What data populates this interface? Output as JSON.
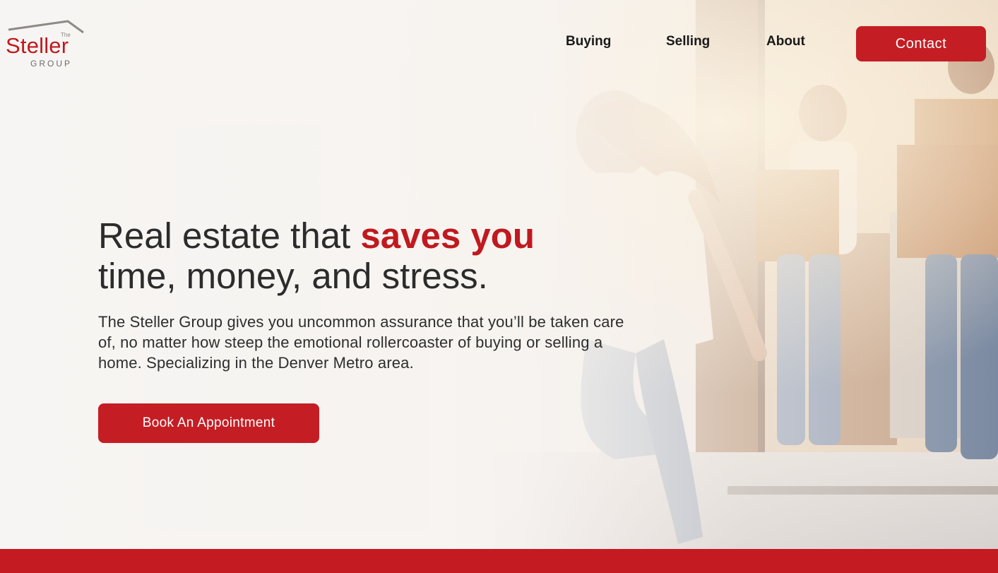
{
  "brand": {
    "the": "The",
    "name": "Steller",
    "group": "GROUP",
    "accent_color": "#c41e24"
  },
  "nav": {
    "buying": "Buying",
    "selling": "Selling",
    "about": "About",
    "contact": "Contact"
  },
  "hero": {
    "headline_part1": "Real estate that ",
    "headline_accent": "saves you",
    "headline_part2": "time, money, and stress.",
    "description": "The Steller Group gives you uncommon assurance that you’ll be taken care of, no matter how steep the emotional rollercoaster of buying or selling a home. Specializing in the Denver Metro area.",
    "cta_label": "Book An Appointment",
    "background_image": "family-moving-into-new-home-photo"
  }
}
